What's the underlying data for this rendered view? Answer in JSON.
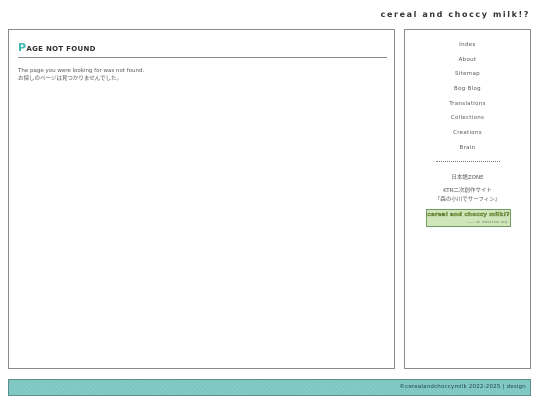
{
  "header": {
    "site_title": "cereal and choccy milk!?"
  },
  "main": {
    "heading_first": "P",
    "heading_rest": "age not found",
    "message_en": "The page you were looking for was not found.",
    "message_ja": "お探しのページは見つかりませんでした。"
  },
  "sidebar": {
    "nav": [
      {
        "label": "Index"
      },
      {
        "label": "About"
      },
      {
        "label": "Sitemap"
      },
      {
        "label": "Bog Blog"
      },
      {
        "label": "Translations"
      },
      {
        "label": "Collections"
      },
      {
        "label": "Creations"
      },
      {
        "label": "Brain"
      }
    ],
    "divider": "----------------------------------------",
    "jp_zone_link": "日本語ZONE",
    "ktr_line1": "KTR二次創作サイト",
    "ktr_line2": "『森の小川でサーフィン』",
    "banner_title": "cereal and choccy milk!?",
    "banner_sub": "———— on neocities.org"
  },
  "footer": {
    "copyright_link": "©cerealandchoccymilk 2022-2025",
    "separator": "|",
    "design_link": "design"
  },
  "colors": {
    "accent": "#3fb8b2",
    "footer_bg": "#7cc6c2",
    "border": "#8a8a8a"
  }
}
